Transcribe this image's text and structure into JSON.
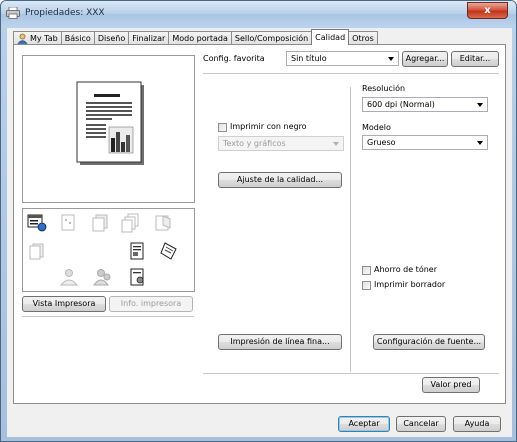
{
  "window": {
    "title": "Propiedades: XXX",
    "close_label": "x"
  },
  "tabs": [
    {
      "label": "My Tab",
      "icon": "user-icon"
    },
    {
      "label": "Básico"
    },
    {
      "label": "Diseño"
    },
    {
      "label": "Finalizar"
    },
    {
      "label": "Modo portada"
    },
    {
      "label": "Sello/Composición"
    },
    {
      "label": "Calidad",
      "active": true
    },
    {
      "label": "Otros"
    }
  ],
  "favorites": {
    "label": "Config. favorita",
    "value": "Sin título",
    "add_label": "Agregar...",
    "edit_label": "Editar..."
  },
  "preview": {
    "vista_impresora": "Vista Impresora",
    "info_impresora": "Info. impresora"
  },
  "quality": {
    "black_label": "Imprimir con negro",
    "text_graphics": "Texto y gráficos",
    "adjust_label": "Ajuste de la calidad...",
    "fine_line_label": "Impresión de línea fina..."
  },
  "resolution": {
    "label": "Resolución",
    "value": "600 dpi (Normal)"
  },
  "model": {
    "label": "Modelo",
    "value": "Grueso"
  },
  "options": {
    "toner_save": "Ahorro de tóner",
    "draft_print": "Imprimir borrador",
    "font_config": "Configuración de fuente..."
  },
  "footer": {
    "default_label": "Valor pred",
    "accept_label": "Aceptar",
    "cancel_label": "Cancelar",
    "help_label": "Ayuda"
  }
}
